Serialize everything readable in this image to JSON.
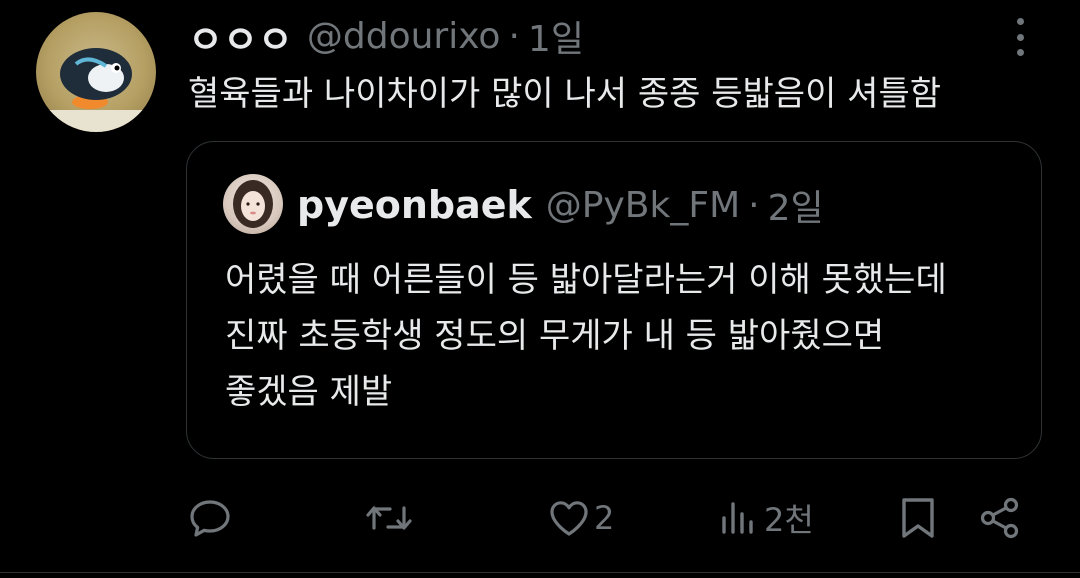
{
  "tweet": {
    "display_name": "ㅇㅇㅇ",
    "handle": "@ddourixo",
    "separator": "·",
    "time": "1일",
    "text": "혈육들과 나이차이가 많이 나서 종종 등밟음이 셔틀함"
  },
  "quote": {
    "display_name": "pyeonbaek",
    "handle": "@PyBk_FM",
    "separator": "·",
    "time": "2일",
    "lines": [
      "어렸을 때 어른들이 등 밟아달라는거 이해 못했는데",
      "진짜 초등학생 정도의 무게가 내 등 밟아줬으면",
      "좋겠음 제발"
    ]
  },
  "actions": {
    "like_count": "2",
    "views_count": "2천"
  },
  "icons": {
    "reply": "reply-icon",
    "retweet": "retweet-icon",
    "like": "heart-icon",
    "views": "views-icon",
    "bookmark": "bookmark-icon",
    "share": "share-icon",
    "more": "more-icon"
  },
  "colors": {
    "background": "#000000",
    "text": "#e7e9ea",
    "muted": "#71767b",
    "border": "#2f3336"
  }
}
